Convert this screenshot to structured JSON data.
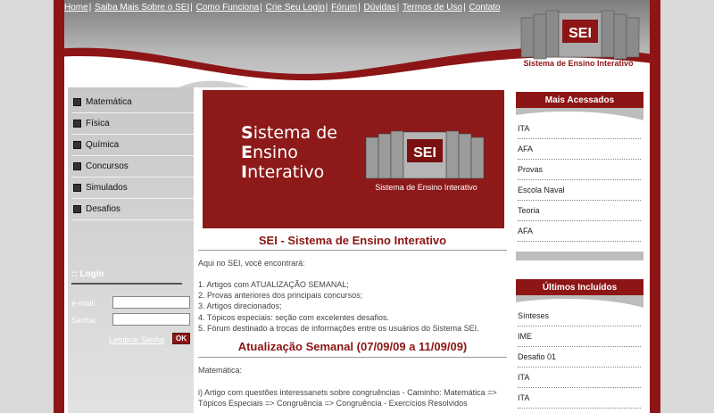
{
  "topnav": {
    "links": [
      "Home",
      "Saiba Mais Sobre o SEI",
      "Como Funciona",
      "Crie Seu Login",
      "Fórum",
      "Dúvidas",
      "Termos de Uso",
      "Contato"
    ]
  },
  "brand": {
    "logo_text": "SEI",
    "caption": "Sistema de Ensino Interativo"
  },
  "leftnav": {
    "items": [
      "Matemática",
      "Física",
      "Química",
      "Concursos",
      "Simulados",
      "Desafios"
    ]
  },
  "login": {
    "title": ":: Login",
    "email_label": "e-mail:",
    "password_label": "Senha:",
    "email_value": "",
    "password_value": "",
    "remember_label": "Lembrar Senha",
    "ok_label": "OK"
  },
  "banner": {
    "line1_initial": "S",
    "line1_rest": "istema de",
    "line2_initial": "E",
    "line2_rest": "nsino",
    "line3_initial": "I",
    "line3_rest": "nterativo",
    "logo_text": "SEI",
    "caption": "Sistema de Ensino Interativo"
  },
  "main": {
    "title": "SEI - Sistema de Ensino Interativo",
    "intro": "Aqui no SEI, você encontrará:",
    "list": [
      "1. Artigos com ATUALIZAÇÃO SEMANAL;",
      "2. Provas anteriores dos principais concursos;",
      "3. Artigos direcionados;",
      "4. Tópicos especiais: seção com excelentes desafios.",
      "5. Fórum destinado a trocas de informações entre os usuários do Sistema SEI."
    ],
    "section_title": "Atualização Semanal (07/09/09 a 11/09/09)",
    "subject": "Matemática:",
    "article": "i) Artigo com questões interessanets sobre congruências - Caminho: Matemática => Tópicos Especiais => Congruência => Congruência - Exercícios Resolvidos"
  },
  "most_accessed": {
    "title": "Mais Acessados",
    "items": [
      "ITA",
      "AFA",
      "Provas",
      "Escola Naval",
      "Teoria",
      "AFA"
    ]
  },
  "latest": {
    "title": "Últimos Incluídos",
    "items": [
      "Sínteses",
      "IME",
      "Desafio 01",
      "ITA",
      "ITA"
    ]
  },
  "colors": {
    "brand_red": "#8d1515",
    "header_gray": "#9a9a9a"
  }
}
